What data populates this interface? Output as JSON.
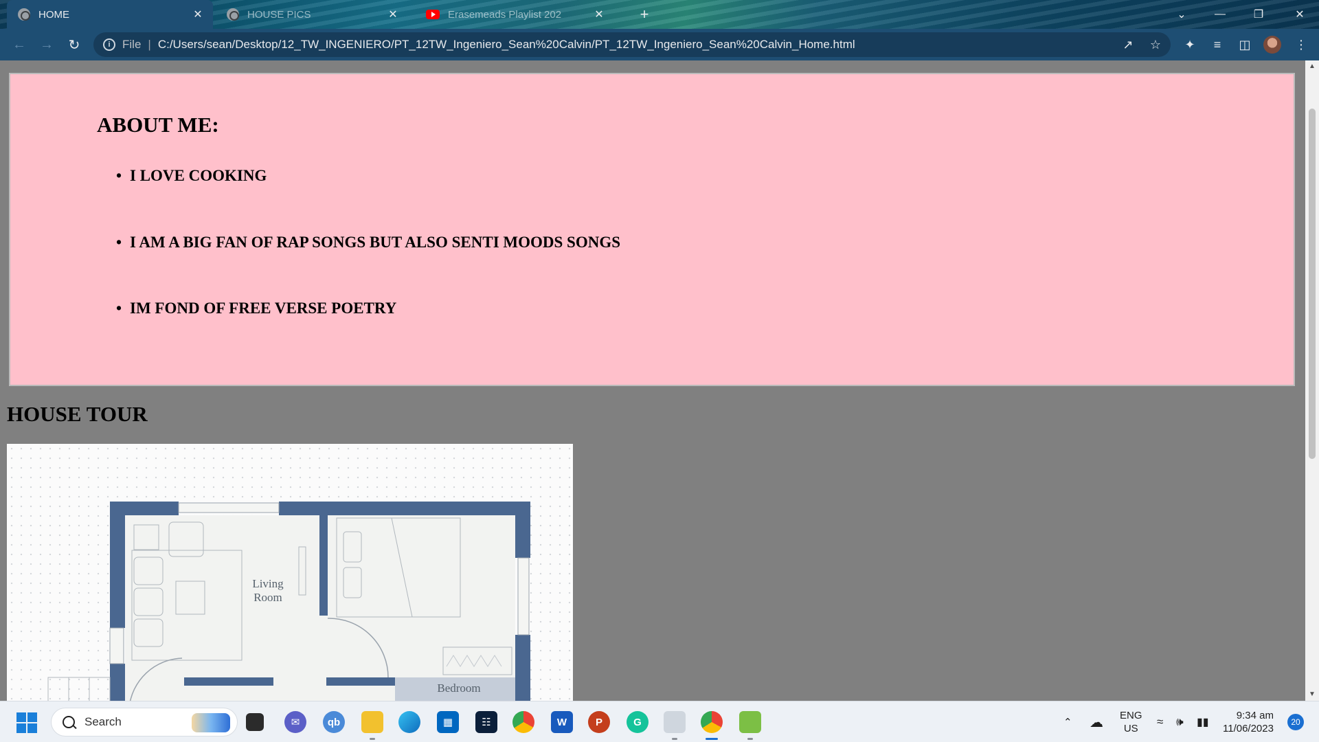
{
  "browser": {
    "tabs": [
      {
        "label": "HOME",
        "icon": "globe-icon",
        "active": true
      },
      {
        "label": "HOUSE PICS",
        "icon": "globe-icon",
        "active": false
      },
      {
        "label": "Erasemeads Playlist 202",
        "icon": "youtube-icon",
        "active": false
      }
    ],
    "close_glyph": "✕",
    "new_tab_glyph": "+",
    "address": {
      "scheme": "File",
      "separator": "|",
      "url": "C:/Users/sean/Desktop/12_TW_INGENIERO/PT_12TW_Ingeniero_Sean%20Calvin/PT_12TW_Ingeniero_Sean%20Calvin_Home.html"
    },
    "window_controls": {
      "dropdown": "⌄",
      "minimize": "—",
      "restore": "❐",
      "close": "✕"
    }
  },
  "page": {
    "about": {
      "heading": "ABOUT ME:",
      "items": [
        "I LOVE COOKING",
        "I AM A BIG FAN OF RAP SONGS BUT ALSO SENTI MOODS SONGS",
        "IM FOND OF FREE VERSE POETRY"
      ],
      "background": "#ffc0cb"
    },
    "house_tour": {
      "title": "HOUSE TOUR",
      "floorplan": {
        "rooms": [
          "Living",
          "Room",
          "Bedroom"
        ],
        "wall_color": "#4a6790"
      }
    },
    "background": "#808080"
  },
  "taskbar": {
    "search_label": "Search",
    "apps": [
      "task-view-icon",
      "teams-icon",
      "qb-app-icon",
      "file-explorer-icon",
      "edge-icon",
      "store-icon",
      "vscode-like-icon",
      "chrome-icon",
      "word-icon",
      "powerpoint-icon",
      "grammarly-icon",
      "notepad-icon",
      "chrome-profile-icon",
      "paint-icon"
    ],
    "app_labels": {
      "qb": "qb",
      "word": "W",
      "powerpoint": "P",
      "grammarly": "G"
    },
    "language": {
      "line1": "ENG",
      "line2": "US"
    },
    "clock": {
      "time": "9:34 am",
      "date": "11/06/2023"
    },
    "notifications": "20"
  }
}
